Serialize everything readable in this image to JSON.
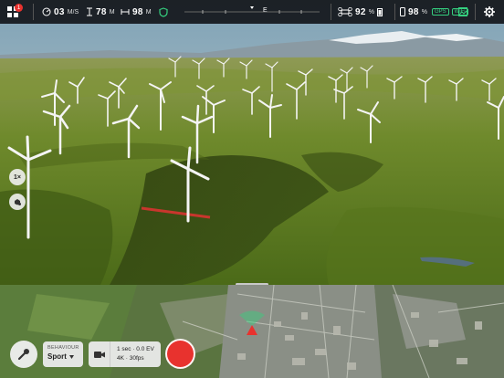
{
  "topbar": {
    "notification_count": "1",
    "altitude": {
      "value": "03",
      "unit": "M/S"
    },
    "height": {
      "value": "78",
      "unit": "M"
    },
    "distance": {
      "value": "98",
      "unit": "M"
    },
    "compass_heading": "E",
    "drone_battery": {
      "value": "92",
      "unit": "%"
    },
    "controller_battery": {
      "value": "98",
      "unit": "%"
    },
    "gps_label": "GPS",
    "wifi_label": "WiFi"
  },
  "left_controls": {
    "zoom_label": "1×"
  },
  "bottom": {
    "behaviour": {
      "title": "BEHAVIOUR",
      "value": "Sport"
    },
    "camera": {
      "line1": "1 sec · 0.0 EV",
      "line2": "4K · 30fps"
    }
  },
  "colors": {
    "accent_green": "#35d07f",
    "record_red": "#e8322e",
    "gps_green": "#35d07f"
  }
}
